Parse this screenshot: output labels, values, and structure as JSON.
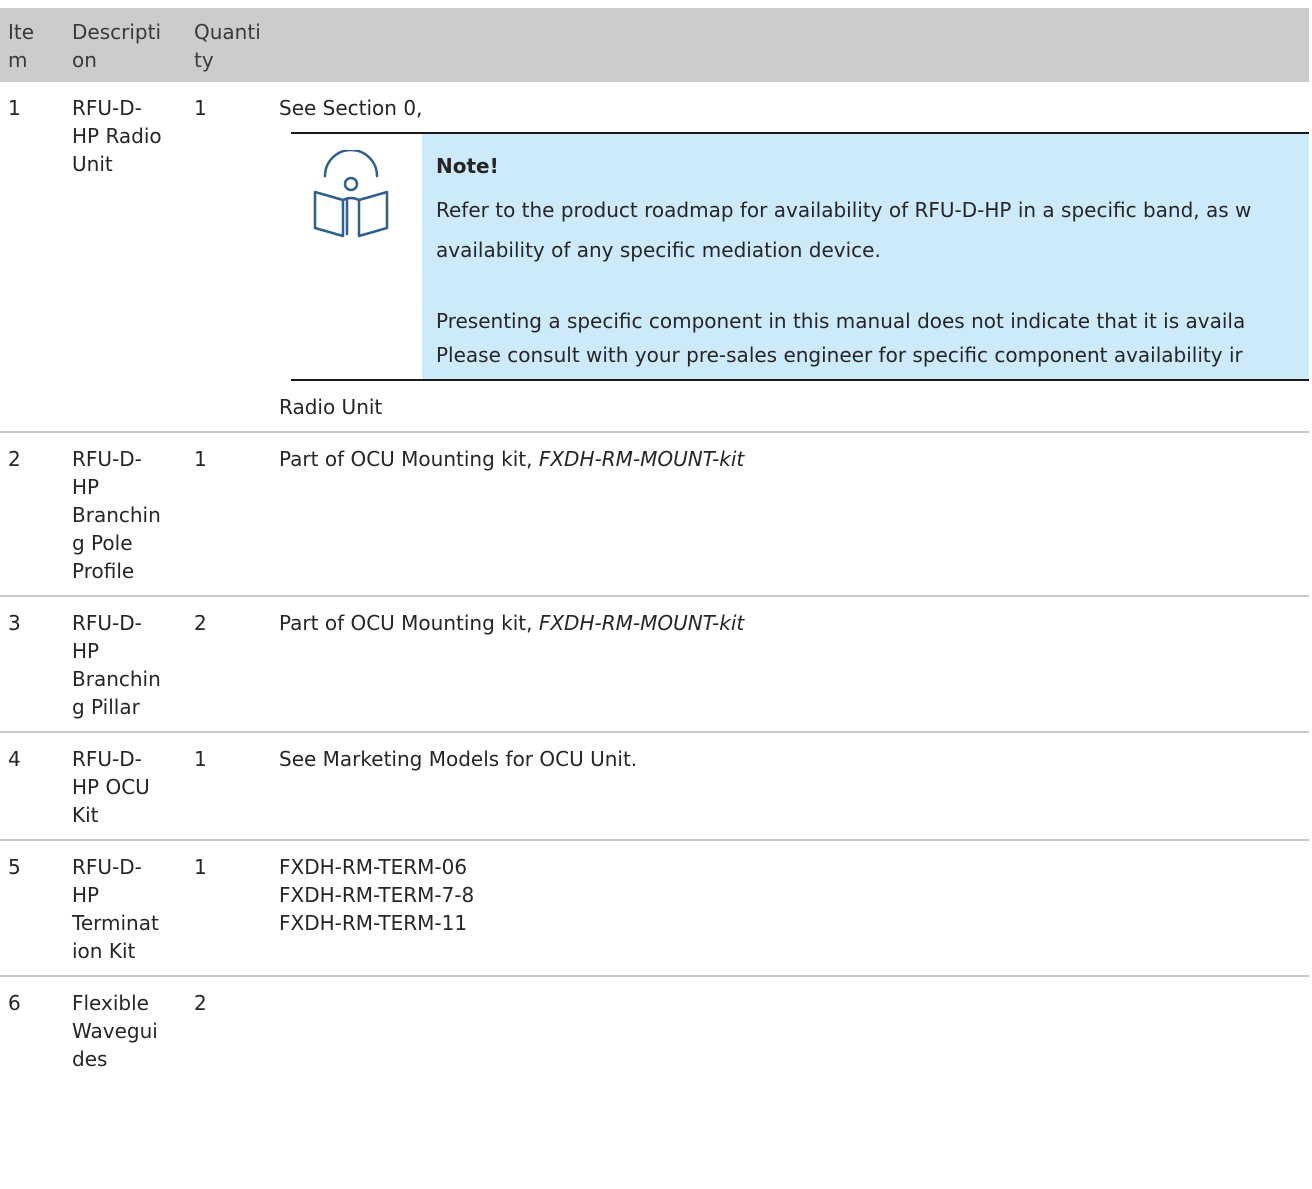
{
  "table": {
    "headers": [
      "Ite\nm",
      "Descripti\non",
      "Quanti\nty",
      ""
    ],
    "header_item_lines": [
      "Ite",
      "m"
    ],
    "header_desc_lines": [
      "Descripti",
      "on"
    ],
    "header_qty_lines": [
      "Quanti",
      "ty"
    ],
    "rows": [
      {
        "item": "1",
        "desc_lines": [
          "RFU-D-",
          "HP Radio",
          "Unit"
        ],
        "qty": "1",
        "detail_line1": "See Section 0,",
        "note": {
          "title": "Note!",
          "para1_line1": "Refer to the product roadmap for availability of RFU-D-HP in a specific band, as w",
          "para1_line2": "availability of any specific mediation device.",
          "para2_line1": "Presenting a specific component in this manual does not indicate that it is availa",
          "para2_line2": "Please consult with your pre-sales engineer for specific component availability ir"
        },
        "detail_after": "Radio Unit"
      },
      {
        "item": "2",
        "desc_lines": [
          "RFU-D-",
          "HP",
          "Branchin",
          "g Pole",
          "Profile"
        ],
        "qty": "1",
        "detail_prefix": "Part of OCU Mounting kit, ",
        "detail_italic": "FXDH-RM-MOUNT-kit"
      },
      {
        "item": "3",
        "desc_lines": [
          "RFU-D-",
          "HP",
          "Branchin",
          "g Pillar"
        ],
        "qty": "2",
        "detail_prefix": "Part of OCU Mounting kit, ",
        "detail_italic": "FXDH-RM-MOUNT-kit"
      },
      {
        "item": "4",
        "desc_lines": [
          "RFU-D-",
          "HP OCU",
          "Kit"
        ],
        "qty": "1",
        "detail": "See Marketing Models for OCU Unit."
      },
      {
        "item": "5",
        "desc_lines": [
          "RFU-D-",
          "HP",
          "Terminat",
          "ion Kit"
        ],
        "qty": "1",
        "detail_lines": [
          "FXDH-RM-TERM-06",
          "FXDH-RM-TERM-7-8",
          "FXDH-RM-TERM-11"
        ]
      },
      {
        "item": "6",
        "desc_lines": [
          "Flexible",
          "Wavegui",
          "des"
        ],
        "qty": "2"
      }
    ]
  },
  "colors": {
    "header_bg": "#cccccc",
    "note_bg": "#cdeafb",
    "icon_stroke": "#2f5f8f",
    "row_rule": "#c9c9c9"
  },
  "icons": {
    "note": "open-book-with-disc-icon"
  }
}
